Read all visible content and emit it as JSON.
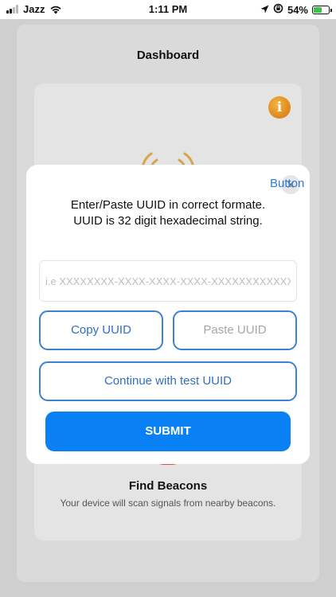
{
  "status_bar": {
    "carrier": "Jazz",
    "time": "1:11 PM",
    "battery_percent": "54%",
    "battery_level": 0.54,
    "icons": [
      "signal-icon",
      "wifi-icon",
      "location-icon",
      "orientation-lock-icon",
      "battery-icon"
    ]
  },
  "app": {
    "title": "Dashboard",
    "card": {
      "info_icon_glyph": "i",
      "find_title": "Find Beacons",
      "find_subtitle": "Your device will scan signals from nearby beacons."
    }
  },
  "dialog": {
    "close_glyph": "✕",
    "button_label": "Button",
    "message_line1": "Enter/Paste UUID in correct formate.",
    "message_line2": "UUID is 32 digit hexadecimal string.",
    "input": {
      "value": "",
      "placeholder": "i.e XXXXXXXX-XXXX-XXXX-XXXX-XXXXXXXXXXXX"
    },
    "copy_label": "Copy UUID",
    "paste_label": "Paste UUID",
    "test_label": "Continue with test UUID",
    "submit_label": "SUBMIT"
  },
  "colors": {
    "accent": "#0a80f5",
    "outline": "#3b7fd9",
    "battery": "#3cc24a",
    "info": "#e08a1e"
  }
}
